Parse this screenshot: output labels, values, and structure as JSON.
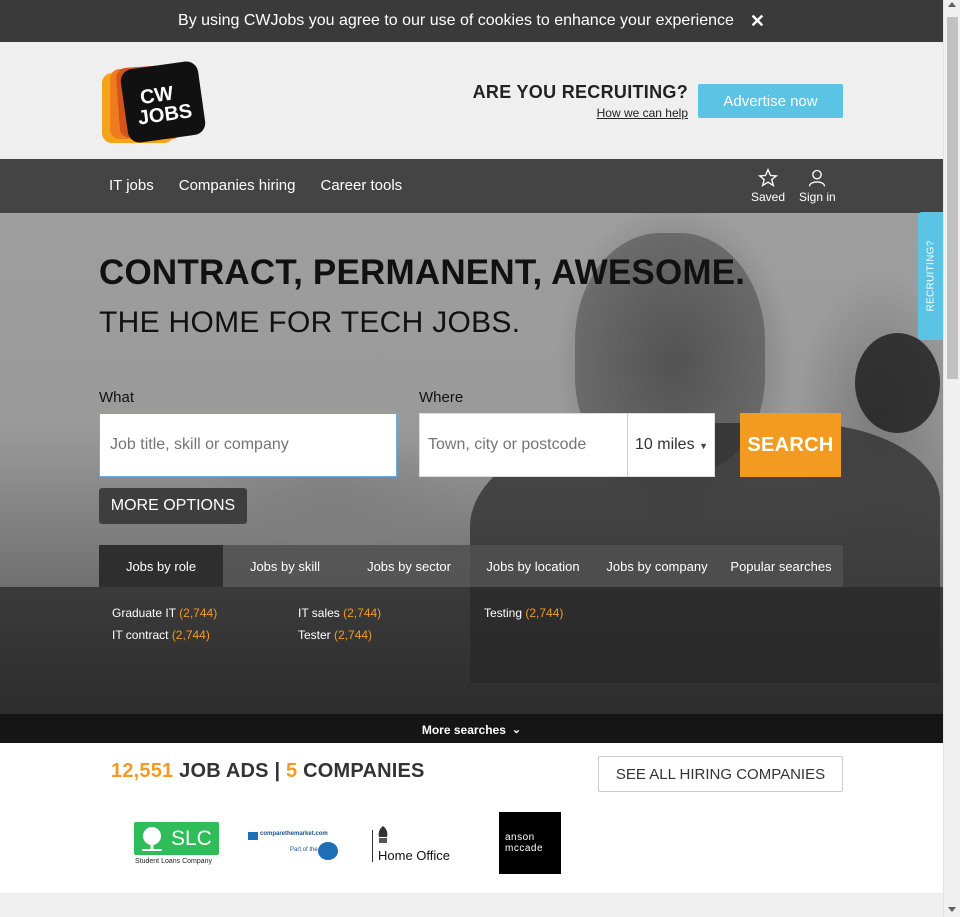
{
  "cookie": {
    "message": "By using CWJobs you agree to our use of cookies to enhance your experience",
    "close": "✕"
  },
  "header": {
    "logo_line1": "CW",
    "logo_line2": "JOBS",
    "recruiting_title": "ARE YOU RECRUITING?",
    "recruiting_link": "How we can help",
    "advertise_label": "Advertise now"
  },
  "nav": {
    "links": [
      "IT jobs",
      "Companies hiring",
      "Career tools"
    ],
    "saved": "Saved",
    "sign_in": "Sign in"
  },
  "hero": {
    "headline": "CONTRACT, PERMANENT, AWESOME.",
    "subheadline": "THE HOME FOR TECH JOBS.",
    "what_label": "What",
    "what_placeholder": "Job title, skill or company",
    "where_label": "Where",
    "where_placeholder": "Town, city or postcode",
    "radius_value": "10 miles",
    "search_label": "SEARCH",
    "more_options_label": "MORE OPTIONS"
  },
  "tabs": {
    "items": [
      "Jobs by role",
      "Jobs by skill",
      "Jobs by sector",
      "Jobs by location",
      "Jobs by company",
      "Popular searches"
    ],
    "active": "Jobs by role",
    "role_links": [
      {
        "label": "Graduate IT",
        "count": "(2,744)"
      },
      {
        "label": "IT sales",
        "count": "(2,744)"
      },
      {
        "label": "Testing",
        "count": "(2,744)"
      },
      {
        "label": "IT contract",
        "count": "(2,744)"
      },
      {
        "label": "Tester",
        "count": "(2,744)"
      }
    ],
    "more_searches": "More searches"
  },
  "recruiting_tab": "RECRUITING?",
  "stats": {
    "job_ads_count": "12,551",
    "job_ads_label": "JOB ADS",
    "separator": "|",
    "companies_count": "5",
    "companies_label": "COMPANIES",
    "see_all_label": "SEE ALL HIRING COMPANIES"
  },
  "companies": {
    "slc_text": "SLC",
    "slc_sub": "Student Loans Company",
    "ctm_text": "comparethemarket.com",
    "ctm_sub": "Part of the",
    "home_office": "Home Office",
    "anson_line1": "anson",
    "anson_line2": "mccade"
  },
  "colors": {
    "accent_orange": "#f39b20",
    "accent_blue": "#5bc4e5",
    "nav_bg": "#444444"
  }
}
